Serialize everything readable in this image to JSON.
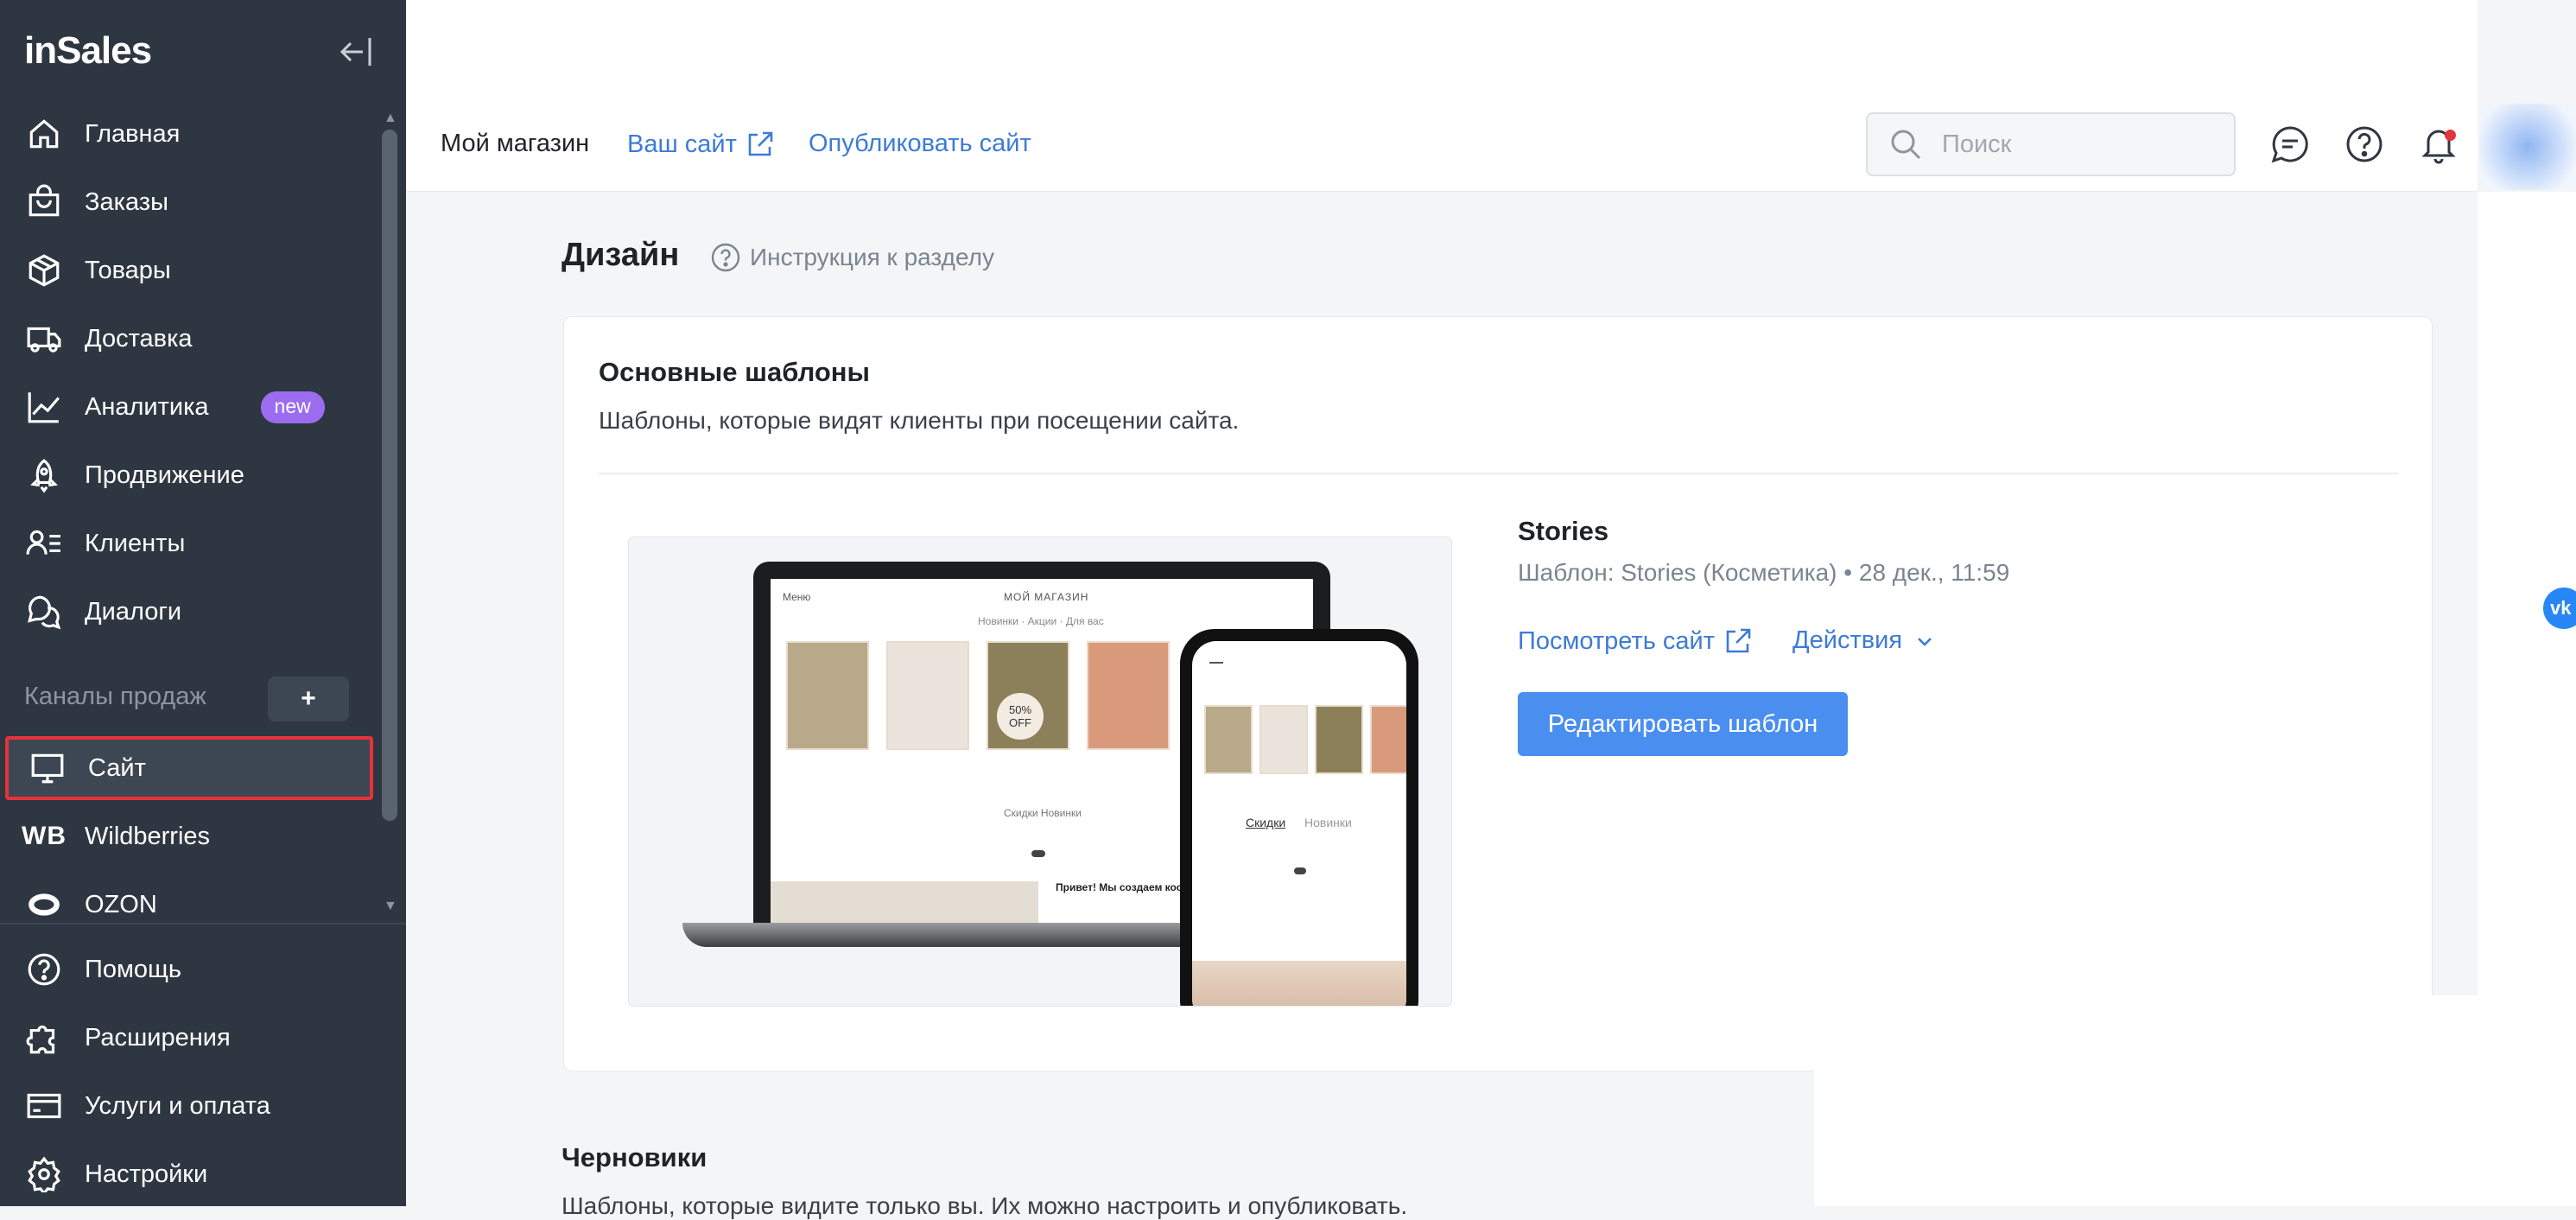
{
  "sidebar": {
    "logo": "inSales",
    "items": [
      {
        "label": "Главная",
        "icon": "home-icon"
      },
      {
        "label": "Заказы",
        "icon": "shopping-bag-icon"
      },
      {
        "label": "Товары",
        "icon": "box-icon"
      },
      {
        "label": "Доставка",
        "icon": "truck-icon"
      },
      {
        "label": "Аналитика",
        "icon": "chart-icon",
        "badge": "new"
      },
      {
        "label": "Продвижение",
        "icon": "rocket-icon"
      },
      {
        "label": "Клиенты",
        "icon": "clients-list-icon"
      },
      {
        "label": "Диалоги",
        "icon": "chat-bubbles-icon"
      }
    ],
    "channels_label": "Каналы продаж",
    "add_channel": "+",
    "channels": [
      {
        "label": "Сайт",
        "icon": "monitor-icon",
        "active": true
      },
      {
        "label": "Wildberries",
        "icon_text": "WB"
      },
      {
        "label": "OZON",
        "icon": "ozon-ring-icon"
      }
    ],
    "bottom_items": [
      {
        "label": "Помощь",
        "icon": "help-circle-icon"
      },
      {
        "label": "Расширения",
        "icon": "puzzle-icon"
      },
      {
        "label": "Услуги и оплата",
        "icon": "card-icon"
      },
      {
        "label": "Настройки",
        "icon": "gear-icon"
      }
    ]
  },
  "topbar": {
    "store": "Мой магазин",
    "your_site": "Ваш сайт",
    "publish": "Опубликовать сайт",
    "search_placeholder": "Поиск"
  },
  "page": {
    "title": "Дизайн",
    "guide": "Инструкция к разделу"
  },
  "main_templates": {
    "title": "Основные шаблоны",
    "description": "Шаблоны, которые видят клиенты при посещении сайта.",
    "template": {
      "name": "Stories",
      "meta": "Шаблон: Stories (Косметика) • 28 дек., 11:59",
      "view_site": "Посмотреть сайт",
      "actions": "Действия",
      "edit": "Редактировать шаблон"
    },
    "preview": {
      "store_name": "МОЙ МАГАЗИН",
      "menu": "Меню",
      "nav": "Новинки · Акции · Для вас",
      "tabs_desktop": "Скидки  Новинки",
      "promo": "50% OFF",
      "banner": "Привет! Мы создаем косметику",
      "tab_sale": "Скидки",
      "tab_new": "Новинки"
    }
  },
  "drafts": {
    "title": "Черновики",
    "description": "Шаблоны, которые видите только вы. Их можно настроить и опубликовать."
  },
  "widget": {
    "vk": "vk"
  },
  "colors": {
    "sidebar": "#2e3741",
    "accent": "#4a8ef0",
    "link": "#3d7bd6",
    "badge": "#9b6cf0",
    "highlight": "#e4343a"
  }
}
